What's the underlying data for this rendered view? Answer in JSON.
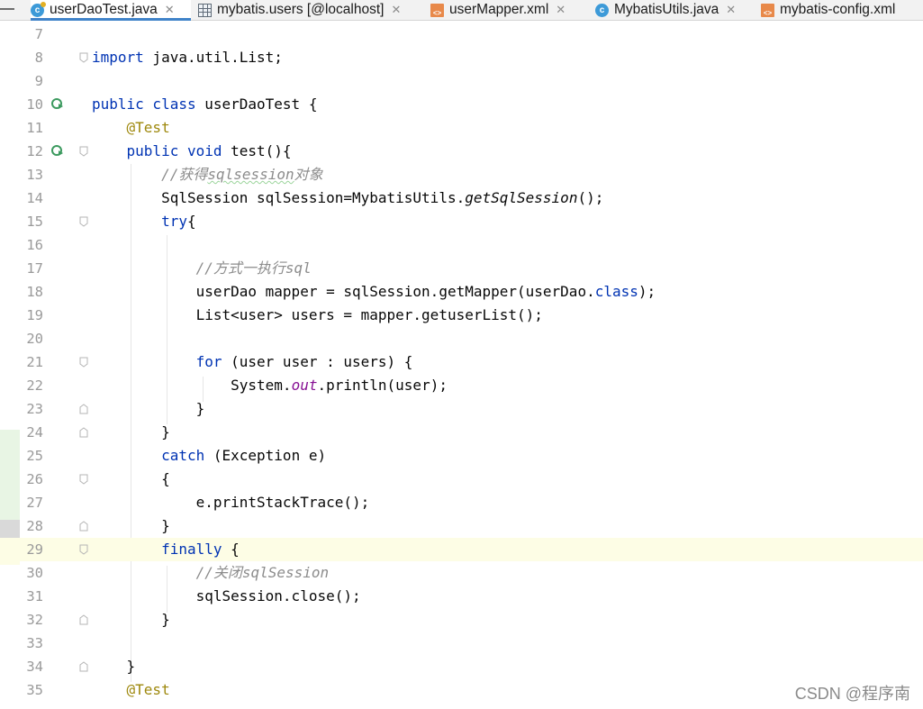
{
  "tabs": [
    {
      "label": "userDaoTest.java",
      "icon": "java-class-icon",
      "active": true
    },
    {
      "label": "mybatis.users [@localhost]",
      "icon": "db-table-icon",
      "active": false
    },
    {
      "label": "userMapper.xml",
      "icon": "xml-file-icon",
      "active": false
    },
    {
      "label": "MybatisUtils.java",
      "icon": "java-class-icon",
      "active": false
    },
    {
      "label": "mybatis-config.xml",
      "icon": "xml-file-icon",
      "active": false
    }
  ],
  "editor": {
    "lines": [
      {
        "num": "7",
        "text": ""
      },
      {
        "num": "8",
        "text": "import java.util.List;"
      },
      {
        "num": "9",
        "text": ""
      },
      {
        "num": "10",
        "text": "public class userDaoTest {"
      },
      {
        "num": "11",
        "text": "    @Test"
      },
      {
        "num": "12",
        "text": "    public void test(){"
      },
      {
        "num": "13",
        "text": "        //获得sqlsession对象"
      },
      {
        "num": "14",
        "text": "        SqlSession sqlSession=MybatisUtils.getSqlSession();"
      },
      {
        "num": "15",
        "text": "        try{"
      },
      {
        "num": "16",
        "text": ""
      },
      {
        "num": "17",
        "text": "            //方式一执行sql"
      },
      {
        "num": "18",
        "text": "            userDao mapper = sqlSession.getMapper(userDao.class);"
      },
      {
        "num": "19",
        "text": "            List<user> users = mapper.getuserList();"
      },
      {
        "num": "20",
        "text": ""
      },
      {
        "num": "21",
        "text": "            for (user user : users) {"
      },
      {
        "num": "22",
        "text": "                System.out.println(user);"
      },
      {
        "num": "23",
        "text": "            }"
      },
      {
        "num": "24",
        "text": "        }"
      },
      {
        "num": "25",
        "text": "        catch (Exception e)"
      },
      {
        "num": "26",
        "text": "        {"
      },
      {
        "num": "27",
        "text": "            e.printStackTrace();"
      },
      {
        "num": "28",
        "text": "        }"
      },
      {
        "num": "29",
        "text": "        finally {"
      },
      {
        "num": "30",
        "text": "            //关闭sqlSession"
      },
      {
        "num": "31",
        "text": "            sqlSession.close();"
      },
      {
        "num": "32",
        "text": "        }"
      },
      {
        "num": "33",
        "text": ""
      },
      {
        "num": "34",
        "text": "    }"
      },
      {
        "num": "35",
        "text": "    @Test"
      }
    ]
  },
  "watermark": "CSDN @程序南",
  "colors": {
    "keyword": "#0033b3",
    "annotation": "#9e880d",
    "comment": "#8c8c8c",
    "static_field": "#871094",
    "tab_active_underline": "#4083c9",
    "gutter_changed": "#e8f5e4",
    "gutter_current": "#d9d9d9",
    "current_line": "#fdfde5",
    "run_icon": "#3c9a5f"
  }
}
